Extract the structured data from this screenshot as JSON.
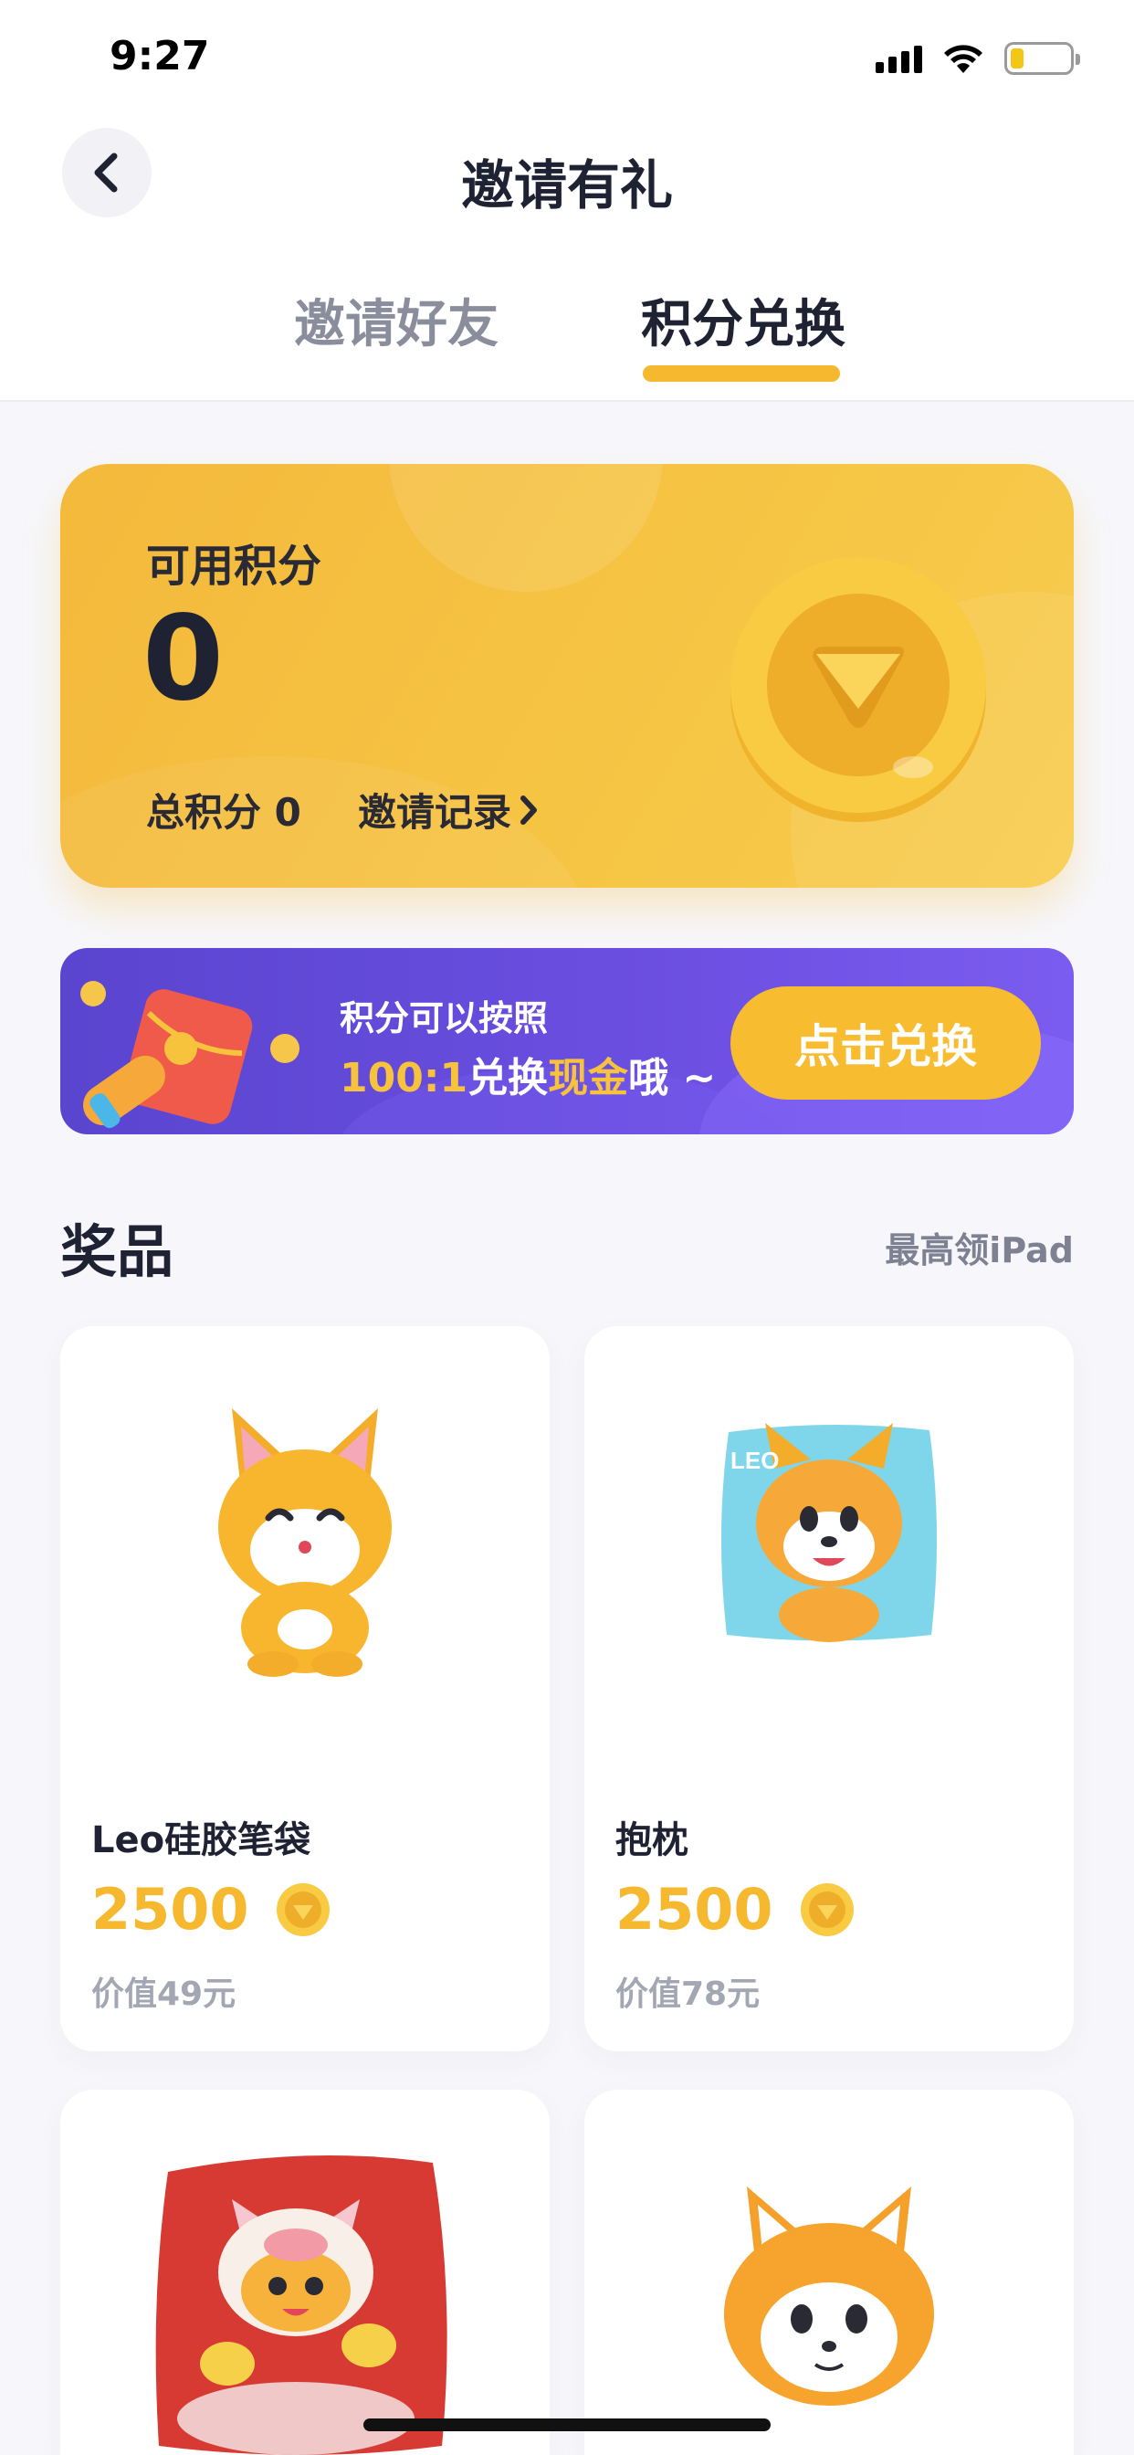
{
  "status_bar": {
    "time": "9:27"
  },
  "header": {
    "title": "邀请有礼"
  },
  "tabs": [
    {
      "label": "邀请好友",
      "active": false
    },
    {
      "label": "积分兑换",
      "active": true
    }
  ],
  "points_card": {
    "label": "可用积分",
    "value": "0",
    "total": "总积分 0",
    "records_link": "邀请记录"
  },
  "banner": {
    "line1": "积分可以按照",
    "ratio": "100:1",
    "text_exchange": "兑换",
    "text_cash": "现金",
    "text_suffix": "哦 ~",
    "button": "点击兑换"
  },
  "prizes": {
    "title": "奖品",
    "subtitle": "最高领iPad",
    "items": [
      {
        "name": "Leo硅胶笔袋",
        "price": "2500",
        "worth": "价值49元"
      },
      {
        "name": "抱枕",
        "price": "2500",
        "worth": "价值78元"
      }
    ]
  },
  "colors": {
    "accent": "#f5b82e",
    "banner_bg": "#5a45cf",
    "text_primary": "#1f2233",
    "text_muted": "#a3a6b3"
  },
  "icons": [
    "back-arrow-icon",
    "signal-icon",
    "wifi-icon",
    "battery-icon",
    "chevron-right-icon",
    "coin-icon",
    "megaphone-icon"
  ]
}
